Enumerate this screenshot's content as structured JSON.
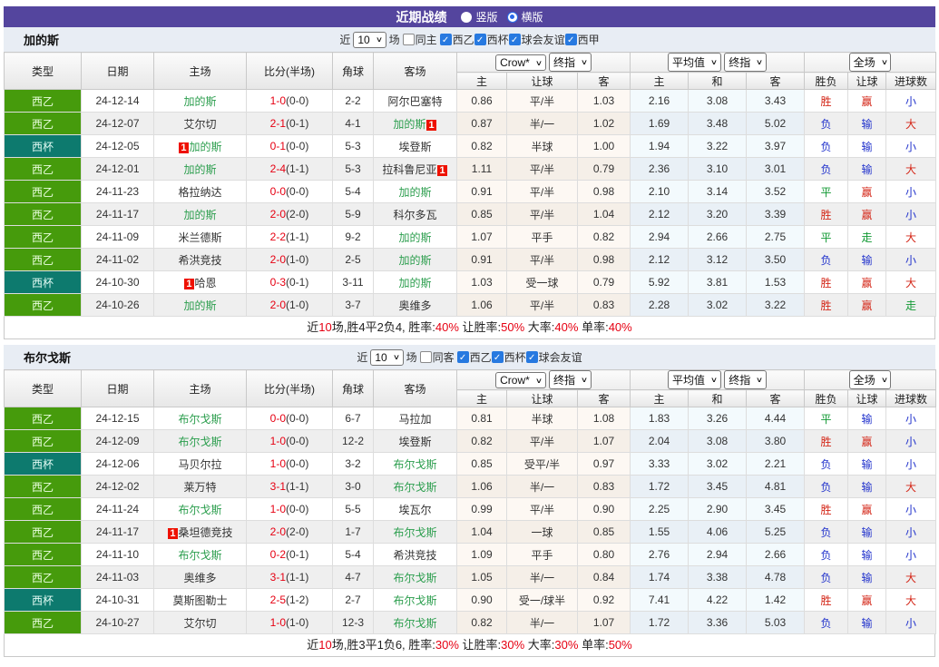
{
  "title_bar": {
    "title": "近期战绩",
    "radio_vertical": "竖版",
    "radio_horizontal": "横版"
  },
  "filter_labels": {
    "near": "近",
    "matches": "场"
  },
  "header": {
    "cols": [
      "类型",
      "日期",
      "主场",
      "比分(半场)",
      "角球",
      "客场"
    ],
    "crow_select": "Crow*",
    "crow_final_select": "终指",
    "crow_subs": [
      "主",
      "让球",
      "客"
    ],
    "avg_select": "平均值",
    "avg_final_select": "终指",
    "avg_subs": [
      "主",
      "和",
      "客"
    ],
    "full_select": "全场",
    "full_subs": [
      "胜负",
      "让球",
      "进球数"
    ]
  },
  "league_colors": {
    "西乙": "green",
    "西杯": "teal"
  },
  "result_colors": {
    "胜": "red",
    "平": "green",
    "负": "blue",
    "赢": "red",
    "输": "blue",
    "走": "green",
    "大": "red",
    "小": "blue"
  },
  "colors": {
    "title_bar": "#54459e",
    "league_green": "#469b0c",
    "league_teal": "#0d7a6e",
    "score_red": "#e60012",
    "focus_team_green": "#2c9e4e",
    "result_blue": "#2233cc"
  },
  "sections": [
    {
      "team": "加的斯",
      "filter": {
        "count": "10",
        "same_side_label": "同主",
        "same_side_checked": false,
        "leagues": [
          "西乙",
          "西杯",
          "球会友谊",
          "西甲"
        ]
      },
      "rows": [
        {
          "type": "西乙",
          "date": "24-12-14",
          "home": "加的斯",
          "home_focus": true,
          "home_badge": "",
          "away": "阿尔巴塞特",
          "away_focus": false,
          "away_badge": "",
          "ft": "1-0",
          "ht": "(0-0)",
          "corner": "2-2",
          "odds": [
            "0.86",
            "平/半",
            "1.03"
          ],
          "avg": [
            "2.16",
            "3.08",
            "3.43"
          ],
          "res": [
            "胜",
            "赢",
            "小"
          ]
        },
        {
          "type": "西乙",
          "date": "24-12-07",
          "home": "艾尔切",
          "home_focus": false,
          "home_badge": "",
          "away": "加的斯",
          "away_focus": true,
          "away_badge": "1",
          "ft": "2-1",
          "ht": "(0-1)",
          "corner": "4-1",
          "odds": [
            "0.87",
            "半/一",
            "1.02"
          ],
          "avg": [
            "1.69",
            "3.48",
            "5.02"
          ],
          "res": [
            "负",
            "输",
            "大"
          ]
        },
        {
          "type": "西杯",
          "date": "24-12-05",
          "home": "加的斯",
          "home_focus": true,
          "home_badge": "1",
          "away": "埃登斯",
          "away_focus": false,
          "away_badge": "",
          "ft": "0-1",
          "ht": "(0-0)",
          "corner": "5-3",
          "odds": [
            "0.82",
            "半球",
            "1.00"
          ],
          "avg": [
            "1.94",
            "3.22",
            "3.97"
          ],
          "res": [
            "负",
            "输",
            "小"
          ]
        },
        {
          "type": "西乙",
          "date": "24-12-01",
          "home": "加的斯",
          "home_focus": true,
          "home_badge": "",
          "away": "拉科鲁尼亚",
          "away_focus": false,
          "away_badge": "1",
          "ft": "2-4",
          "ht": "(1-1)",
          "corner": "5-3",
          "odds": [
            "1.11",
            "平/半",
            "0.79"
          ],
          "avg": [
            "2.36",
            "3.10",
            "3.01"
          ],
          "res": [
            "负",
            "输",
            "大"
          ]
        },
        {
          "type": "西乙",
          "date": "24-11-23",
          "home": "格拉纳达",
          "home_focus": false,
          "home_badge": "",
          "away": "加的斯",
          "away_focus": true,
          "away_badge": "",
          "ft": "0-0",
          "ht": "(0-0)",
          "corner": "5-4",
          "odds": [
            "0.91",
            "平/半",
            "0.98"
          ],
          "avg": [
            "2.10",
            "3.14",
            "3.52"
          ],
          "res": [
            "平",
            "赢",
            "小"
          ]
        },
        {
          "type": "西乙",
          "date": "24-11-17",
          "home": "加的斯",
          "home_focus": true,
          "home_badge": "",
          "away": "科尔多瓦",
          "away_focus": false,
          "away_badge": "",
          "ft": "2-0",
          "ht": "(2-0)",
          "corner": "5-9",
          "odds": [
            "0.85",
            "平/半",
            "1.04"
          ],
          "avg": [
            "2.12",
            "3.20",
            "3.39"
          ],
          "res": [
            "胜",
            "赢",
            "小"
          ]
        },
        {
          "type": "西乙",
          "date": "24-11-09",
          "home": "米兰德斯",
          "home_focus": false,
          "home_badge": "",
          "away": "加的斯",
          "away_focus": true,
          "away_badge": "",
          "ft": "2-2",
          "ht": "(1-1)",
          "corner": "9-2",
          "odds": [
            "1.07",
            "平手",
            "0.82"
          ],
          "avg": [
            "2.94",
            "2.66",
            "2.75"
          ],
          "res": [
            "平",
            "走",
            "大"
          ]
        },
        {
          "type": "西乙",
          "date": "24-11-02",
          "home": "希洪竞技",
          "home_focus": false,
          "home_badge": "",
          "away": "加的斯",
          "away_focus": true,
          "away_badge": "",
          "ft": "2-0",
          "ht": "(1-0)",
          "corner": "2-5",
          "odds": [
            "0.91",
            "平/半",
            "0.98"
          ],
          "avg": [
            "2.12",
            "3.12",
            "3.50"
          ],
          "res": [
            "负",
            "输",
            "小"
          ]
        },
        {
          "type": "西杯",
          "date": "24-10-30",
          "home": "哈恩",
          "home_focus": false,
          "home_badge": "1",
          "away": "加的斯",
          "away_focus": true,
          "away_badge": "",
          "ft": "0-3",
          "ht": "(0-1)",
          "corner": "3-11",
          "odds": [
            "1.03",
            "受一球",
            "0.79"
          ],
          "avg": [
            "5.92",
            "3.81",
            "1.53"
          ],
          "res": [
            "胜",
            "赢",
            "大"
          ]
        },
        {
          "type": "西乙",
          "date": "24-10-26",
          "home": "加的斯",
          "home_focus": true,
          "home_badge": "",
          "away": "奥维多",
          "away_focus": false,
          "away_badge": "",
          "ft": "2-0",
          "ht": "(1-0)",
          "corner": "3-7",
          "odds": [
            "1.06",
            "平/半",
            "0.83"
          ],
          "avg": [
            "2.28",
            "3.02",
            "3.22"
          ],
          "res": [
            "胜",
            "赢",
            "走"
          ]
        }
      ],
      "summary": [
        [
          "近",
          "k"
        ],
        [
          "10",
          "r"
        ],
        [
          "场,胜4平2负4, 胜率:",
          "k"
        ],
        [
          "40%",
          "r"
        ],
        [
          " 让胜率:",
          "k"
        ],
        [
          "50%",
          "r"
        ],
        [
          " 大率:",
          "k"
        ],
        [
          "40%",
          "r"
        ],
        [
          " 单率:",
          "k"
        ],
        [
          "40%",
          "r"
        ]
      ]
    },
    {
      "team": "布尔戈斯",
      "filter": {
        "count": "10",
        "same_side_label": "同客",
        "same_side_checked": false,
        "leagues": [
          "西乙",
          "西杯",
          "球会友谊"
        ]
      },
      "rows": [
        {
          "type": "西乙",
          "date": "24-12-15",
          "home": "布尔戈斯",
          "home_focus": true,
          "home_badge": "",
          "away": "马拉加",
          "away_focus": false,
          "away_badge": "",
          "ft": "0-0",
          "ht": "(0-0)",
          "corner": "6-7",
          "odds": [
            "0.81",
            "半球",
            "1.08"
          ],
          "avg": [
            "1.83",
            "3.26",
            "4.44"
          ],
          "res": [
            "平",
            "输",
            "小"
          ]
        },
        {
          "type": "西乙",
          "date": "24-12-09",
          "home": "布尔戈斯",
          "home_focus": true,
          "home_badge": "",
          "away": "埃登斯",
          "away_focus": false,
          "away_badge": "",
          "ft": "1-0",
          "ht": "(0-0)",
          "corner": "12-2",
          "odds": [
            "0.82",
            "平/半",
            "1.07"
          ],
          "avg": [
            "2.04",
            "3.08",
            "3.80"
          ],
          "res": [
            "胜",
            "赢",
            "小"
          ]
        },
        {
          "type": "西杯",
          "date": "24-12-06",
          "home": "马贝尔拉",
          "home_focus": false,
          "home_badge": "",
          "away": "布尔戈斯",
          "away_focus": true,
          "away_badge": "",
          "ft": "1-0",
          "ht": "(0-0)",
          "corner": "3-2",
          "odds": [
            "0.85",
            "受平/半",
            "0.97"
          ],
          "avg": [
            "3.33",
            "3.02",
            "2.21"
          ],
          "res": [
            "负",
            "输",
            "小"
          ]
        },
        {
          "type": "西乙",
          "date": "24-12-02",
          "home": "莱万特",
          "home_focus": false,
          "home_badge": "",
          "away": "布尔戈斯",
          "away_focus": true,
          "away_badge": "",
          "ft": "3-1",
          "ht": "(1-1)",
          "corner": "3-0",
          "odds": [
            "1.06",
            "半/一",
            "0.83"
          ],
          "avg": [
            "1.72",
            "3.45",
            "4.81"
          ],
          "res": [
            "负",
            "输",
            "大"
          ]
        },
        {
          "type": "西乙",
          "date": "24-11-24",
          "home": "布尔戈斯",
          "home_focus": true,
          "home_badge": "",
          "away": "埃瓦尔",
          "away_focus": false,
          "away_badge": "",
          "ft": "1-0",
          "ht": "(0-0)",
          "corner": "5-5",
          "odds": [
            "0.99",
            "平/半",
            "0.90"
          ],
          "avg": [
            "2.25",
            "2.90",
            "3.45"
          ],
          "res": [
            "胜",
            "赢",
            "小"
          ]
        },
        {
          "type": "西乙",
          "date": "24-11-17",
          "home": "桑坦德竞技",
          "home_focus": false,
          "home_badge": "1",
          "away": "布尔戈斯",
          "away_focus": true,
          "away_badge": "",
          "ft": "2-0",
          "ht": "(2-0)",
          "corner": "1-7",
          "odds": [
            "1.04",
            "一球",
            "0.85"
          ],
          "avg": [
            "1.55",
            "4.06",
            "5.25"
          ],
          "res": [
            "负",
            "输",
            "小"
          ]
        },
        {
          "type": "西乙",
          "date": "24-11-10",
          "home": "布尔戈斯",
          "home_focus": true,
          "home_badge": "",
          "away": "希洪竞技",
          "away_focus": false,
          "away_badge": "",
          "ft": "0-2",
          "ht": "(0-1)",
          "corner": "5-4",
          "odds": [
            "1.09",
            "平手",
            "0.80"
          ],
          "avg": [
            "2.76",
            "2.94",
            "2.66"
          ],
          "res": [
            "负",
            "输",
            "小"
          ]
        },
        {
          "type": "西乙",
          "date": "24-11-03",
          "home": "奥维多",
          "home_focus": false,
          "home_badge": "",
          "away": "布尔戈斯",
          "away_focus": true,
          "away_badge": "",
          "ft": "3-1",
          "ht": "(1-1)",
          "corner": "4-7",
          "odds": [
            "1.05",
            "半/一",
            "0.84"
          ],
          "avg": [
            "1.74",
            "3.38",
            "4.78"
          ],
          "res": [
            "负",
            "输",
            "大"
          ]
        },
        {
          "type": "西杯",
          "date": "24-10-31",
          "home": "莫斯图勒士",
          "home_focus": false,
          "home_badge": "",
          "away": "布尔戈斯",
          "away_focus": true,
          "away_badge": "",
          "ft": "2-5",
          "ht": "(1-2)",
          "corner": "2-7",
          "odds": [
            "0.90",
            "受一/球半",
            "0.92"
          ],
          "avg": [
            "7.41",
            "4.22",
            "1.42"
          ],
          "res": [
            "胜",
            "赢",
            "大"
          ]
        },
        {
          "type": "西乙",
          "date": "24-10-27",
          "home": "艾尔切",
          "home_focus": false,
          "home_badge": "",
          "away": "布尔戈斯",
          "away_focus": true,
          "away_badge": "",
          "ft": "1-0",
          "ht": "(1-0)",
          "corner": "12-3",
          "odds": [
            "0.82",
            "半/一",
            "1.07"
          ],
          "avg": [
            "1.72",
            "3.36",
            "5.03"
          ],
          "res": [
            "负",
            "输",
            "小"
          ]
        }
      ],
      "summary": [
        [
          "近",
          "k"
        ],
        [
          "10",
          "r"
        ],
        [
          "场,胜3平1负6, 胜率:",
          "k"
        ],
        [
          "30%",
          "r"
        ],
        [
          " 让胜率:",
          "k"
        ],
        [
          "30%",
          "r"
        ],
        [
          " 大率:",
          "k"
        ],
        [
          "30%",
          "r"
        ],
        [
          " 单率:",
          "k"
        ],
        [
          "50%",
          "r"
        ]
      ]
    }
  ]
}
